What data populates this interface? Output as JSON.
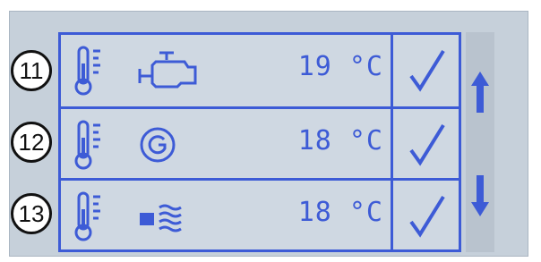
{
  "rows": [
    {
      "id": "11",
      "icon": "engine-icon",
      "temperature": "19 °C",
      "status_icon": "checkmark-icon"
    },
    {
      "id": "12",
      "icon": "generator-icon",
      "temperature": "18 °C",
      "status_icon": "checkmark-icon"
    },
    {
      "id": "13",
      "icon": "heater-icon",
      "temperature": "18 °C",
      "status_icon": "checkmark-icon"
    }
  ],
  "scroll": {
    "up_icon": "arrow-up-icon",
    "down_icon": "arrow-down-icon"
  },
  "colors": {
    "lcd_text": "#3d5bd6",
    "lcd_background": "#c6d0da",
    "badge_border": "#111111"
  }
}
